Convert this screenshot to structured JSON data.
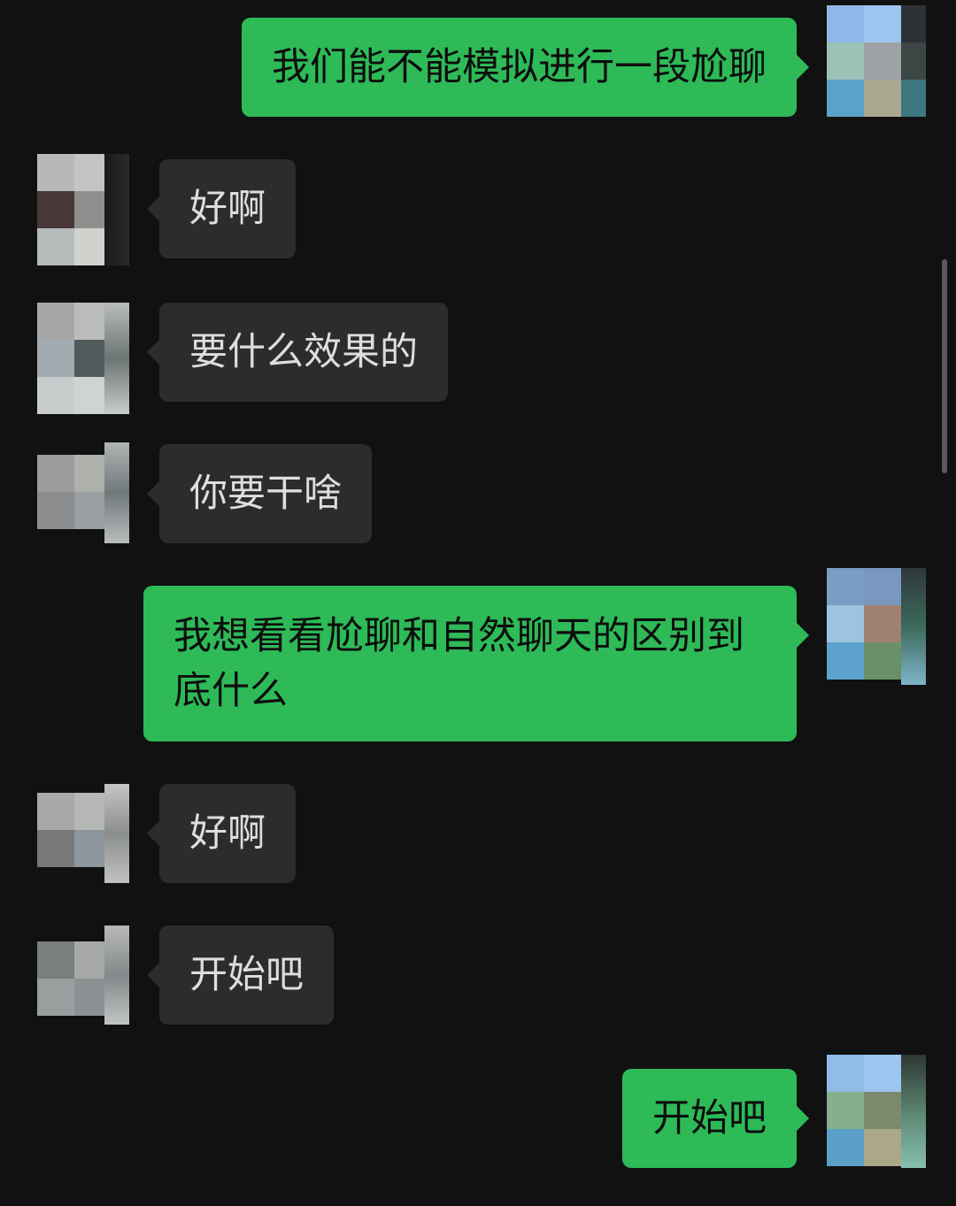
{
  "messages": [
    {
      "side": "right",
      "text": "我们能不能模拟进行一段尬聊"
    },
    {
      "side": "left",
      "text": "好啊"
    },
    {
      "side": "left",
      "text": "要什么效果的"
    },
    {
      "side": "left",
      "text": "你要干啥"
    },
    {
      "side": "right",
      "text": "我想看看尬聊和自然聊天的区别到底什么"
    },
    {
      "side": "left",
      "text": "好啊"
    },
    {
      "side": "left",
      "text": "开始吧"
    },
    {
      "side": "right",
      "text": "开始吧"
    }
  ],
  "colors": {
    "background": "#111111",
    "incoming_bubble": "#2c2c2c",
    "outgoing_bubble": "#2dba57",
    "incoming_text": "#dedede",
    "outgoing_text": "#0d0d0d"
  }
}
